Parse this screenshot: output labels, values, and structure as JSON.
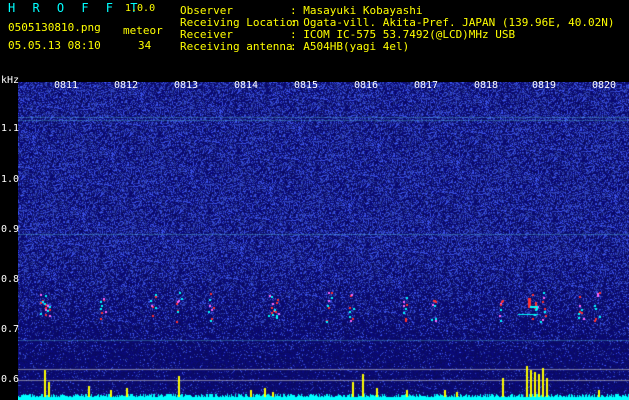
{
  "app": {
    "title": "H R O F F T",
    "version": "1.0.0",
    "filename": "0505130810.png",
    "datetime": "05.05.13 08:10",
    "meteor_label": "meteor",
    "meteor_count": "34"
  },
  "info": [
    {
      "label": "Observer",
      "value": ": Masayuki Kobayashi"
    },
    {
      "label": "Receiving Location",
      "value": ": Ogata-vill. Akita-Pref. JAPAN (139.96E, 40.02N)"
    },
    {
      "label": "Receiver",
      "value": ": ICOM IC-575 53.7492(@LCD)MHz USB"
    },
    {
      "label": "Receiving antenna",
      "value": ": A504HB(yagi 4el)"
    }
  ],
  "time_ticks": [
    "0811",
    "0812",
    "0813",
    "0814",
    "0815",
    "0816",
    "0817",
    "0818",
    "0819",
    "0820"
  ],
  "freq_axis": {
    "unit": "kHz",
    "labels": [
      "1.1",
      "1.0",
      "0.9",
      "0.8",
      "0.7",
      "0.6"
    ]
  },
  "colors": {
    "bg": "#000000",
    "spectrogram_bg": "#0b0b70",
    "noise": "#3d53ff",
    "echo_hot": "#ff3030",
    "echo_cyan": "#00ffff",
    "amp_bar": "#ffff00"
  }
}
